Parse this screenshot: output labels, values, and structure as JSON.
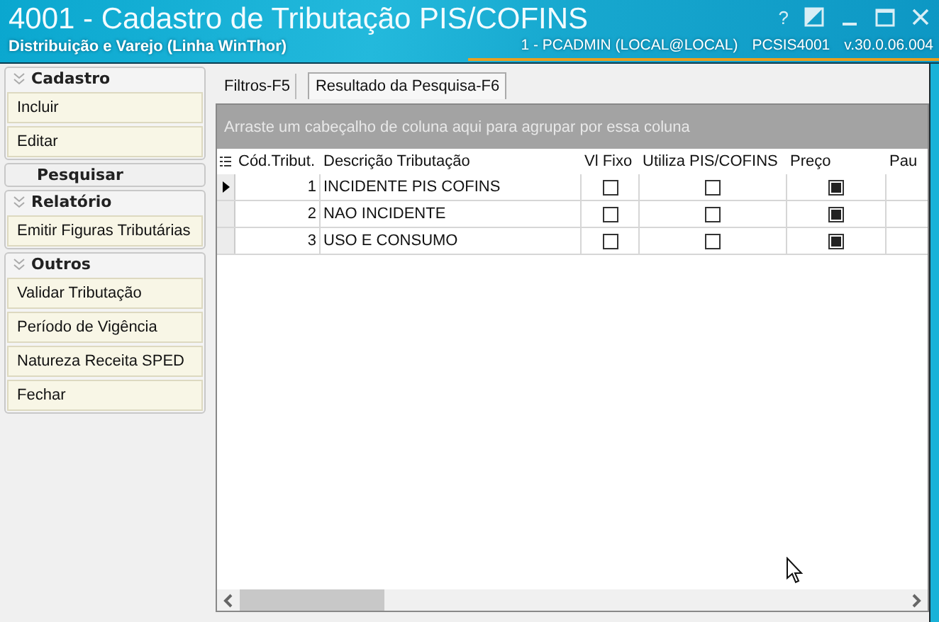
{
  "window": {
    "title": "4001 - Cadastro de Tributação PIS/COFINS",
    "subtitle": "Distribuição e Varejo (Linha WinThor)",
    "user": "1 - PCADMIN (LOCAL@LOCAL)",
    "program": "PCSIS4001",
    "version": "v.30.0.06.004",
    "help": "?"
  },
  "sidebar": {
    "groups": [
      {
        "kind": "group",
        "title": "Cadastro",
        "items": [
          "Incluir",
          "Editar"
        ]
      },
      {
        "kind": "single",
        "title": "Pesquisar"
      },
      {
        "kind": "group",
        "title": "Relatório",
        "items": [
          "Emitir Figuras Tributárias"
        ]
      },
      {
        "kind": "group",
        "title": "Outros",
        "items": [
          "Validar Tributação",
          "Período de Vigência",
          "Natureza Receita SPED",
          "Fechar"
        ]
      }
    ]
  },
  "tabs": [
    {
      "label": "Filtros-F5",
      "selected": false
    },
    {
      "label": "Resultado da Pesquisa-F6",
      "selected": true
    }
  ],
  "grid": {
    "group_hint": "Arraste um cabeçalho de coluna aqui para agrupar por essa coluna",
    "columns": [
      "Cód.Tribut.",
      "Descrição Tributação",
      "Vl Fixo",
      "Utiliza PIS/COFINS",
      "Preço",
      "Pau"
    ],
    "rows": [
      {
        "code": "1",
        "description": "INCIDENTE PIS COFINS",
        "vl_fixo": false,
        "utiliza": false,
        "preco": true,
        "selected": true
      },
      {
        "code": "2",
        "description": "NAO INCIDENTE",
        "vl_fixo": false,
        "utiliza": false,
        "preco": true,
        "selected": false
      },
      {
        "code": "3",
        "description": "USO E CONSUMO",
        "vl_fixo": false,
        "utiliza": false,
        "preco": true,
        "selected": false
      }
    ]
  }
}
